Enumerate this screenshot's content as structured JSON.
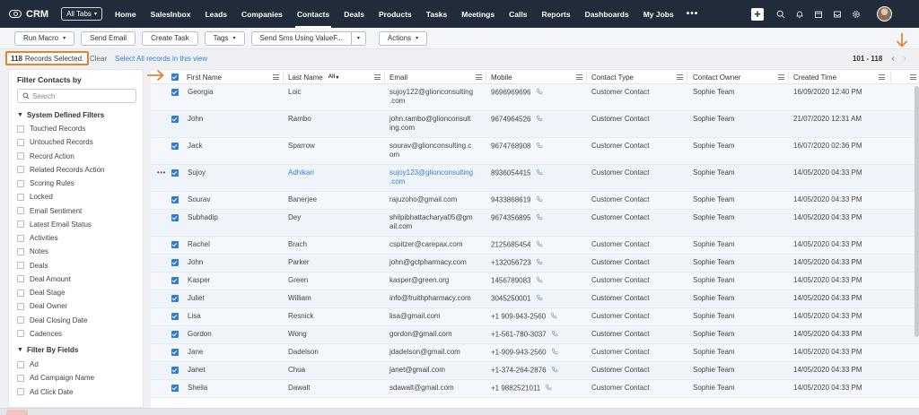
{
  "app": {
    "name": "CRM",
    "all_tabs_label": "All Tabs"
  },
  "nav": {
    "tabs": [
      "Home",
      "SalesInbox",
      "Leads",
      "Companies",
      "Contacts",
      "Deals",
      "Products",
      "Tasks",
      "Meetings",
      "Calls",
      "Reports",
      "Dashboards",
      "My Jobs"
    ],
    "active": "Contacts",
    "more_label": "•••",
    "icons": [
      "plus-icon",
      "search-icon",
      "bell-icon",
      "calendar-icon",
      "inbox-icon",
      "gear-icon"
    ]
  },
  "toolbar": {
    "run_macro": "Run Macro",
    "send_email": "Send Email",
    "create_task": "Create Task",
    "tags": "Tags",
    "send_sms": "Send Sms Using ValueF...",
    "actions": "Actions"
  },
  "selection": {
    "count": "118",
    "count_label": "Records Selected.",
    "clear": "Clear",
    "select_all": "Select All records in this view"
  },
  "pager": {
    "range": "101 - 118"
  },
  "sidebar": {
    "title": "Filter Contacts by",
    "search_placeholder": "Search",
    "system_group": "System Defined Filters",
    "system_filters": [
      "Touched Records",
      "Untouched Records",
      "Record Action",
      "Related Records Action",
      "Scoring Rules",
      "Locked",
      "Email Sentiment",
      "Latest Email Status",
      "Activities",
      "Notes",
      "Deals",
      "Deal Amount",
      "Deal Stage",
      "Deal Owner",
      "Deal Closing Date",
      "Cadences"
    ],
    "field_group": "Filter By Fields",
    "field_filters": [
      "Ad",
      "Ad Campaign Name",
      "Ad Click Date"
    ]
  },
  "table": {
    "columns": {
      "first_name": "First Name",
      "last_name": "Last Name",
      "last_name_badge": "All",
      "email": "Email",
      "mobile": "Mobile",
      "contact_type": "Contact Type",
      "contact_owner": "Contact Owner",
      "created_time": "Created Time"
    },
    "rows": [
      {
        "first": "Georgia",
        "last": "Loic",
        "email": [
          "sujoy122@glionconsulting",
          ".com"
        ],
        "mobile": "9696969696",
        "type": "Customer Contact",
        "owner": "Sophie Team",
        "created": "16/09/2020 12:40 PM"
      },
      {
        "first": "John",
        "last": "Rambo",
        "email": [
          "john.rambo@glionconsult",
          "ing.com"
        ],
        "mobile": "9674964526",
        "type": "Customer Contact",
        "owner": "Sophie Team",
        "created": "21/07/2020 12:31 AM"
      },
      {
        "first": "Jack",
        "last": "Sparrow",
        "email": [
          "sourav@glionconsulting.c",
          "om"
        ],
        "mobile": "9674768908",
        "type": "Customer Contact",
        "owner": "Sophie Team",
        "created": "16/07/2020 02:36 PM"
      },
      {
        "first": "Sujoy",
        "last": "Adhikari",
        "email": [
          "sujoy123@glionconsulting",
          ".com"
        ],
        "mobile": "8936054415",
        "type": "Customer Contact",
        "owner": "Sophie Team",
        "created": "14/05/2020 04:33 PM"
      },
      {
        "first": "Sourav",
        "last": "Banerjee",
        "email": [
          "rajuzoho@gmail.com"
        ],
        "mobile": "9433868619",
        "type": "Customer Contact",
        "owner": "Sophie Team",
        "created": "14/05/2020 04:33 PM"
      },
      {
        "first": "Subhadip",
        "last": "Dey",
        "email": [
          "shilpibhattacharya05@gm",
          "ail.com"
        ],
        "mobile": "9674356895",
        "type": "Customer Contact",
        "owner": "Sophie Team",
        "created": "14/05/2020 04:33 PM"
      },
      {
        "first": "Rachel",
        "last": "Brach",
        "email": [
          "cspitzer@carepax.com"
        ],
        "mobile": "2125685454",
        "type": "Customer Contact",
        "owner": "Sophie Team",
        "created": "14/05/2020 04:33 PM"
      },
      {
        "first": "John",
        "last": "Parker",
        "email": [
          "john@gctpharmacy.com"
        ],
        "mobile": "+132056723",
        "type": "Customer Contact",
        "owner": "Sophie Team",
        "created": "14/05/2020 04:33 PM"
      },
      {
        "first": "Kasper",
        "last": "Green",
        "email": [
          "kasper@green.org"
        ],
        "mobile": "1456789083",
        "type": "Customer Contact",
        "owner": "Sophie Team",
        "created": "14/05/2020 04:33 PM"
      },
      {
        "first": "Juliet",
        "last": "William",
        "email": [
          "info@fruithpharmacy.com"
        ],
        "mobile": "3045250001",
        "type": "Customer Contact",
        "owner": "Sophie Team",
        "created": "14/05/2020 04:33 PM"
      },
      {
        "first": "Lisa",
        "last": "Resnick",
        "email": [
          "lisa@gmail.com"
        ],
        "mobile": "+1 909-943-2560",
        "type": "Customer Contact",
        "owner": "Sophie Team",
        "created": "14/05/2020 04:33 PM"
      },
      {
        "first": "Gordon",
        "last": "Wong",
        "email": [
          "gordon@gmail.com"
        ],
        "mobile": "+1-561-780-3037",
        "type": "Customer Contact",
        "owner": "Sophie Team",
        "created": "14/05/2020 04:33 PM"
      },
      {
        "first": "Jane",
        "last": "Dadelson",
        "email": [
          "jdadelson@gmail.com"
        ],
        "mobile": "+1-909-943-2560",
        "type": "Customer Contact",
        "owner": "Sophie Team",
        "created": "14/05/2020 04:33 PM"
      },
      {
        "first": "Janet",
        "last": "Chua",
        "email": [
          "janet@gmail.com"
        ],
        "mobile": "+1-374-264-2876",
        "type": "Customer Contact",
        "owner": "Sophie Team",
        "created": "14/05/2020 04:33 PM"
      },
      {
        "first": "Sheila",
        "last": "Dawalt",
        "email": [
          "sdawalt@gmail.com"
        ],
        "mobile": "+1 9882521011",
        "type": "Customer Contact",
        "owner": "Sophie Team",
        "created": "14/05/2020 04:33 PM"
      }
    ],
    "hovered_row": 3
  },
  "colors": {
    "nav_bg": "#222b39",
    "accent": "#2f7bd9",
    "highlight": "#e8822a",
    "link": "#3a7fd5"
  }
}
